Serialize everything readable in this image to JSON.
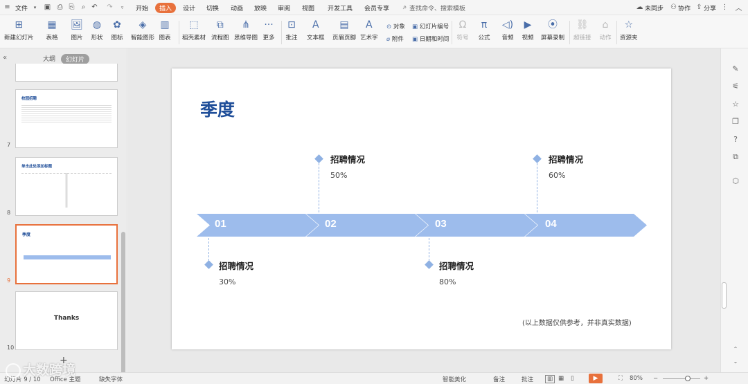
{
  "menubar": {
    "file": "文件",
    "tabs": [
      "开始",
      "插入",
      "设计",
      "切换",
      "动画",
      "放映",
      "审阅",
      "视图",
      "开发工具",
      "会员专享"
    ],
    "search_placeholder": "查找命令、搜索模板",
    "sync": "未同步",
    "collab": "协作",
    "share": "分享"
  },
  "ribbon": {
    "new_slide": "新建幻灯片",
    "table": "表格",
    "picture": "图片",
    "shape": "形状",
    "icon": "图标",
    "smart_shape": "智能图形",
    "chart": "图表",
    "daoke": "稻壳素材",
    "flowchart": "流程图",
    "mindmap": "思维导图",
    "more": "更多",
    "comment": "批注",
    "textbox": "文本框",
    "header_footer": "页眉页脚",
    "wordart": "艺术字",
    "object": "对象",
    "attachment": "附件",
    "slide_number": "幻灯片编号",
    "datetime": "日期和时间",
    "symbol": "符号",
    "formula": "公式",
    "audio": "音频",
    "video": "视频",
    "screen_record": "屏幕录制",
    "hyperlink": "超链接",
    "action": "动作",
    "resource": "资源夹"
  },
  "leftpane": {
    "outline": "大纲",
    "slides": "幻灯片",
    "thumbs": [
      {
        "num": "7",
        "title": "校园招聘"
      },
      {
        "num": "8",
        "title": "单击此处添加标题"
      },
      {
        "num": "9",
        "title": "季度"
      },
      {
        "num": "10",
        "title": "Thanks"
      }
    ]
  },
  "slide": {
    "title": "季度",
    "arrows": [
      "01",
      "02",
      "03",
      "04"
    ],
    "items": [
      {
        "caption": "招聘情况",
        "value": "30%"
      },
      {
        "caption": "招聘情况",
        "value": "50%"
      },
      {
        "caption": "招聘情况",
        "value": "80%"
      },
      {
        "caption": "招聘情况",
        "value": "60%"
      }
    ],
    "note": "(以上数据仅供参考，并非真实数据)",
    "colors": {
      "title": "#1f4e99",
      "arrow": "#9dbcec",
      "diamond": "#8fb1e3"
    }
  },
  "statusbar": {
    "page": "幻灯片 9 / 10",
    "theme": "Office 主题",
    "font_missing": "缺失字体",
    "beautify": "智能美化",
    "notes": "备注",
    "comment": "批注",
    "zoom": "80%"
  },
  "watermark": "大数跨境"
}
